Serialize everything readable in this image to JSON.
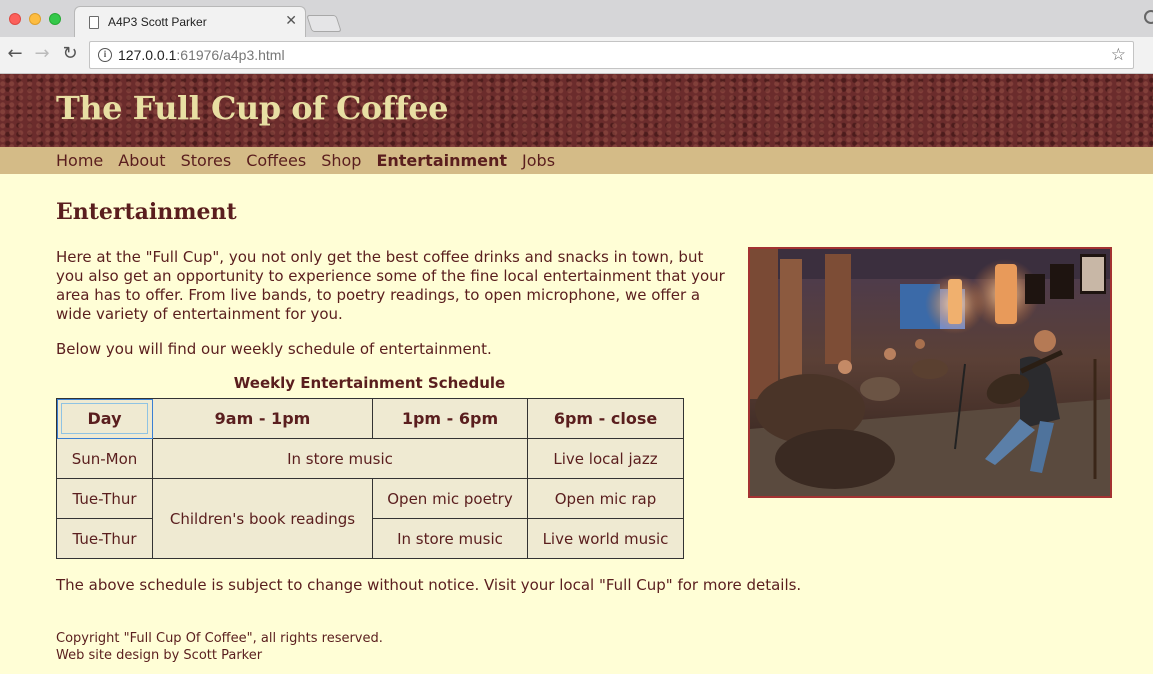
{
  "browser": {
    "tab_title": "A4P3 Scott Parker",
    "url_host": "127.0.0.1",
    "url_rest": ":61976/a4p3.html"
  },
  "site": {
    "title": "The Full Cup of Coffee",
    "nav": [
      "Home",
      "About",
      "Stores",
      "Coffees",
      "Shop",
      "Entertainment",
      "Jobs"
    ],
    "active_nav": "Entertainment"
  },
  "main": {
    "heading": "Entertainment",
    "intro": "Here at the \"Full Cup\", you not only get the best coffee drinks and snacks in town, but you also get an opportunity to experience some of the fine local entertainment that your area has to offer. From live bands, to poetry readings, to open microphone, we offer a wide variety of entertainment for you.",
    "below": "Below you will find our weekly schedule of entertainment.",
    "notice": "The above schedule is subject to change without notice. Visit your local \"Full Cup\" for more details."
  },
  "schedule": {
    "caption": "Weekly Entertainment Schedule",
    "headers": [
      "Day",
      "9am - 1pm",
      "1pm - 6pm",
      "6pm - close"
    ],
    "row1": {
      "day": "Sun-Mon",
      "morning_afternoon": "In store music",
      "evening": "Live local jazz"
    },
    "row2": {
      "day": "Tue-Thur",
      "morning": "Children's book readings",
      "afternoon": "Open mic poetry",
      "evening": "Open mic rap"
    },
    "row3": {
      "day": "Tue-Thur",
      "afternoon": "In store music",
      "evening": "Live world music"
    }
  },
  "footer": {
    "copyright": "Copyright \"Full Cup Of Coffee\", all rights reserved.",
    "design": "Web site design by Scott Parker"
  },
  "colors": {
    "page_bg": "#fffed6",
    "banner": "#6b2c2c",
    "title": "#e8dfa3",
    "navbar": "#d4bb87",
    "text": "#5a1e1e",
    "table_bg": "#efead2",
    "photo_border": "#a33232"
  }
}
